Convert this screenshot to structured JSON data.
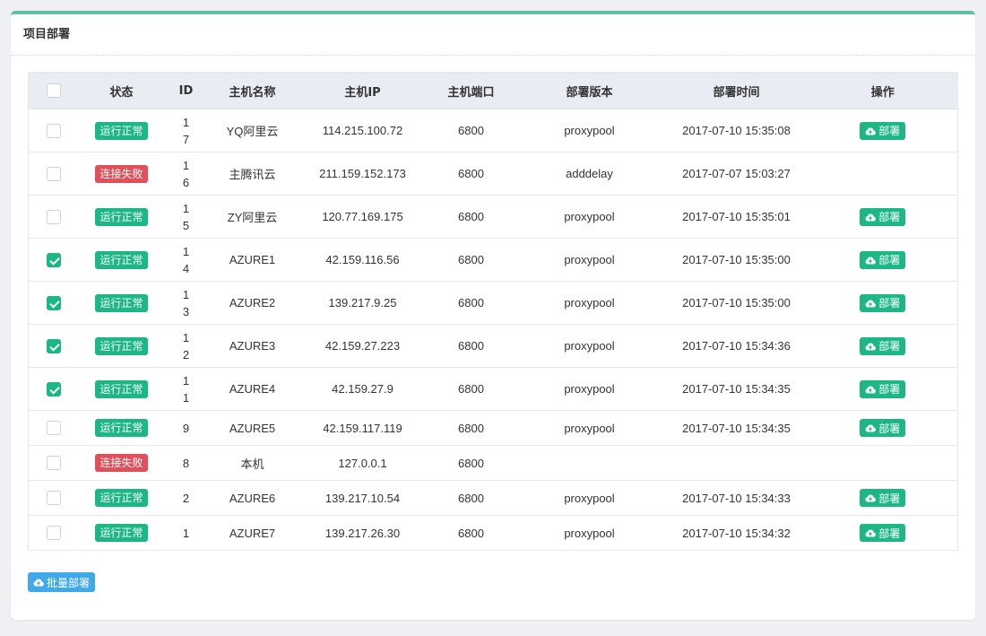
{
  "panel": {
    "title": "项目部署"
  },
  "table": {
    "headers": {
      "status": "状态",
      "id": "ID",
      "name": "主机名称",
      "ip": "主机IP",
      "port": "主机端口",
      "version": "部署版本",
      "time": "部署时间",
      "action": "操作"
    },
    "rows": [
      {
        "checked": false,
        "status": "运行正常",
        "status_type": "ok",
        "id": "17",
        "name": "YQ阿里云",
        "ip": "114.215.100.72",
        "port": "6800",
        "version": "proxypool",
        "time": "2017-07-10 15:35:08",
        "action": "部署",
        "show_action": true
      },
      {
        "checked": false,
        "status": "连接失败",
        "status_type": "fail",
        "id": "16",
        "name": "主腾讯云",
        "ip": "211.159.152.173",
        "port": "6800",
        "version": "adddelay",
        "time": "2017-07-07 15:03:27",
        "action": "",
        "show_action": false
      },
      {
        "checked": false,
        "status": "运行正常",
        "status_type": "ok",
        "id": "15",
        "name": "ZY阿里云",
        "ip": "120.77.169.175",
        "port": "6800",
        "version": "proxypool",
        "time": "2017-07-10 15:35:01",
        "action": "部署",
        "show_action": true
      },
      {
        "checked": true,
        "status": "运行正常",
        "status_type": "ok",
        "id": "14",
        "name": "AZURE1",
        "ip": "42.159.116.56",
        "port": "6800",
        "version": "proxypool",
        "time": "2017-07-10 15:35:00",
        "action": "部署",
        "show_action": true
      },
      {
        "checked": true,
        "status": "运行正常",
        "status_type": "ok",
        "id": "13",
        "name": "AZURE2",
        "ip": "139.217.9.25",
        "port": "6800",
        "version": "proxypool",
        "time": "2017-07-10 15:35:00",
        "action": "部署",
        "show_action": true
      },
      {
        "checked": true,
        "status": "运行正常",
        "status_type": "ok",
        "id": "12",
        "name": "AZURE3",
        "ip": "42.159.27.223",
        "port": "6800",
        "version": "proxypool",
        "time": "2017-07-10 15:34:36",
        "action": "部署",
        "show_action": true
      },
      {
        "checked": true,
        "status": "运行正常",
        "status_type": "ok",
        "id": "11",
        "name": "AZURE4",
        "ip": "42.159.27.9",
        "port": "6800",
        "version": "proxypool",
        "time": "2017-07-10 15:34:35",
        "action": "部署",
        "show_action": true
      },
      {
        "checked": false,
        "status": "运行正常",
        "status_type": "ok",
        "id": "9",
        "name": "AZURE5",
        "ip": "42.159.117.119",
        "port": "6800",
        "version": "proxypool",
        "time": "2017-07-10 15:34:35",
        "action": "部署",
        "show_action": true
      },
      {
        "checked": false,
        "status": "连接失败",
        "status_type": "fail",
        "id": "8",
        "name": "本机",
        "ip": "127.0.0.1",
        "port": "6800",
        "version": "",
        "time": "",
        "action": "",
        "show_action": false
      },
      {
        "checked": false,
        "status": "运行正常",
        "status_type": "ok",
        "id": "2",
        "name": "AZURE6",
        "ip": "139.217.10.54",
        "port": "6800",
        "version": "proxypool",
        "time": "2017-07-10 15:34:33",
        "action": "部署",
        "show_action": true
      },
      {
        "checked": false,
        "status": "运行正常",
        "status_type": "ok",
        "id": "1",
        "name": "AZURE7",
        "ip": "139.217.26.30",
        "port": "6800",
        "version": "proxypool",
        "time": "2017-07-10 15:34:32",
        "action": "部署",
        "show_action": true
      }
    ]
  },
  "batch_button": {
    "label": "批量部署"
  },
  "colors": {
    "accent": "#1db685",
    "danger": "#e0505a",
    "info": "#3fa9e9",
    "panel_top": "#5cc3a0"
  },
  "icons": {
    "deploy": "cloud-upload-icon",
    "batch": "cloud-upload-icon"
  }
}
